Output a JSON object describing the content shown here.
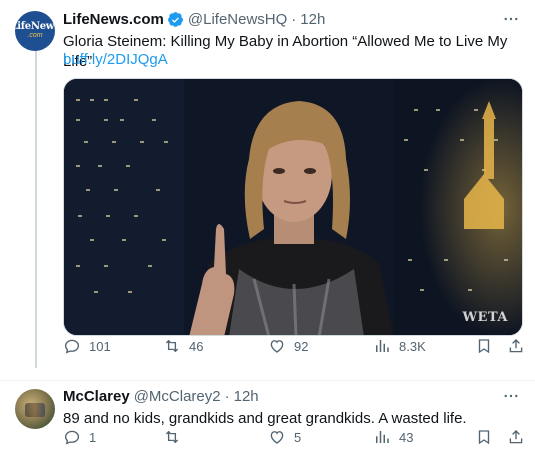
{
  "tweet": {
    "name": "LifeNews.com",
    "handle": "@LifeNewsHQ",
    "dot": "·",
    "time": "12h",
    "avatar_text_top": "LifeNews",
    "avatar_text_bottom": ".com",
    "text": "Gloria Steinem: Killing My Baby in Abortion “Allowed Me to Live My Life”",
    "link": "buff.ly/2DIJQgA",
    "media_watermark": "WETA",
    "stats": {
      "replies": "101",
      "retweets": "46",
      "likes": "92",
      "views": "8.3K"
    }
  },
  "reply": {
    "name": "McClarey",
    "handle": "@McClarey2",
    "dot": "·",
    "time": "12h",
    "text": "89 and no kids, grandkids and great grandkids.  A wasted life.",
    "stats": {
      "replies": "1",
      "retweets": "",
      "likes": "5",
      "views": "43"
    }
  },
  "colors": {
    "accent": "#1d9bf0",
    "muted": "#536471",
    "text": "#0f1419",
    "line": "#cfd9de"
  }
}
